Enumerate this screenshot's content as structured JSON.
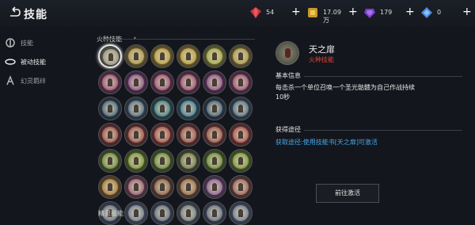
{
  "header": {
    "title": "技能",
    "resources": [
      {
        "icon": "ruby-gem-icon",
        "value": "54",
        "color": "#c8323a"
      },
      {
        "icon": "gold-ingot-icon",
        "value": "17.09万",
        "color": "#c89a2e"
      },
      {
        "icon": "amethyst-gem-icon",
        "value": "179",
        "color": "#7a3ec8"
      },
      {
        "icon": "diamond-gem-icon",
        "value": "0",
        "color": "#4a8ae0"
      }
    ]
  },
  "sidebar": {
    "items": [
      {
        "label": "技能",
        "icon": "ring-icon",
        "active": false
      },
      {
        "label": "被动技能",
        "icon": "swirl-icon",
        "active": true
      },
      {
        "label": "幻灵羁绊",
        "icon": "phantom-icon",
        "active": false
      }
    ]
  },
  "skills_panel": {
    "section_title": "火种技能",
    "footer_section": "精灵技能",
    "rows": [
      [
        "#8a8a78",
        "#a08a3a",
        "#b09430",
        "#b09430",
        "#9aa03a",
        "#a08a3a"
      ],
      [
        "#8a3a6a",
        "#7a3a7a",
        "#8a3a6a",
        "#8a3a6a",
        "#7a3a7a",
        "#8a3a6a"
      ],
      [
        "#2a4a6a",
        "#3a5a7a",
        "#2a6a7a",
        "#2a6a8a",
        "#2a4a6a",
        "#3a5a7a"
      ],
      [
        "#8a3a3a",
        "#8a3a3a",
        "#9a3a3a",
        "#8a3a3a",
        "#8a3a3a",
        "#9a3a3a"
      ],
      [
        "#5a7a2a",
        "#6a8a2a",
        "#5a7a2a",
        "#5a6a3a",
        "#5a7a2a",
        "#6a8a2a"
      ],
      [
        "#9a6a2a",
        "#8a4a6a",
        "#7a4a3a",
        "#8a5a3a",
        "#7a4a8a",
        "#8a4a4a"
      ],
      [
        "#4a5a7a",
        "#5a6a8a",
        "#4a5a7a",
        "#5a6a7a",
        "#4a5a7a",
        "#5a6a8a"
      ]
    ]
  },
  "detail": {
    "icon": "sanctuary-skill-icon",
    "name": "天之扉",
    "type": "火种技能",
    "basic_label": "基本信息",
    "description_line1": "每击杀一个单位召唤一个圣光骷髅为自己作战持续",
    "description_line2": "10秒",
    "obtain_label": "获得途径",
    "obtain_text": "获取途径:使用技能书[天之扉]可激活",
    "button_label": "前往激活"
  }
}
